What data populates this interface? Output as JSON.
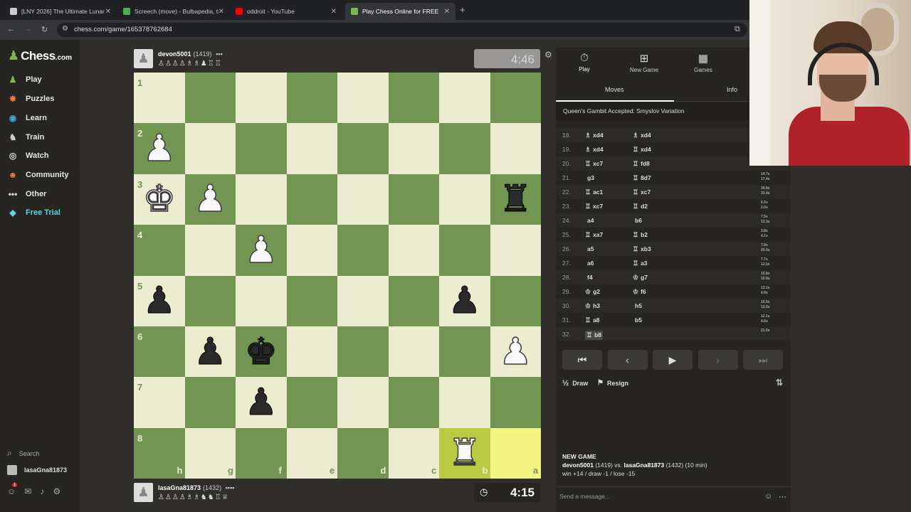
{
  "browser": {
    "tabs": [
      {
        "title": "[LNY 2026] The Ultimate Lunar",
        "color": "#cccccc",
        "active": false
      },
      {
        "title": "Screech (move) - Bulbapedia, th",
        "color": "#4caf50",
        "active": false
      },
      {
        "title": "oddroit - YouTube",
        "color": "#ff0000",
        "active": false
      },
      {
        "title": "Play Chess Online for FREE",
        "color": "#81b64c",
        "active": true
      }
    ],
    "url": "chess.com/game/165378762684"
  },
  "sidebar": {
    "logo_text": "Chess",
    "logo_suffix": ".com",
    "items": [
      {
        "label": "Play",
        "icon": "play-icon",
        "glyph": "♟",
        "color": "#81b64c"
      },
      {
        "label": "Puzzles",
        "icon": "puzzles-icon",
        "glyph": "✸",
        "color": "#f07b3f"
      },
      {
        "label": "Learn",
        "icon": "learn-icon",
        "glyph": "◉",
        "color": "#3fa7d6"
      },
      {
        "label": "Train",
        "icon": "train-icon",
        "glyph": "♞",
        "color": "#cccccc"
      },
      {
        "label": "Watch",
        "icon": "watch-icon",
        "glyph": "◎",
        "color": "#dddddd"
      },
      {
        "label": "Community",
        "icon": "community-icon",
        "glyph": "☻",
        "color": "#e07b39"
      },
      {
        "label": "Other",
        "icon": "other-icon",
        "glyph": "•••",
        "color": "#dddddd"
      },
      {
        "label": "Free Trial",
        "icon": "diamond-icon",
        "glyph": "◆",
        "color": "#5fd3e8"
      }
    ],
    "search_label": "Search",
    "username": "lasaGna81873",
    "notification_count": "1"
  },
  "game": {
    "top_player": {
      "name": "devon5001",
      "rating": "(1419)",
      "flag": "▪▪▪",
      "captured": "♙♙♙♙♗♗♟♖♖",
      "clock": "4:46"
    },
    "bottom_player": {
      "name": "lasaGna81873",
      "rating": "(1432)",
      "flag": "▪▪▪▪",
      "captured": "♙♙♙♙♗♗♞♞♖♕",
      "clock": "4:15"
    },
    "ranks": [
      "1",
      "2",
      "3",
      "4",
      "5",
      "6",
      "7",
      "8"
    ],
    "files": [
      "h",
      "g",
      "f",
      "e",
      "d",
      "c",
      "b",
      "a"
    ],
    "pieces": [
      {
        "glyph": "♟",
        "color": "w",
        "col": 0,
        "row": 1
      },
      {
        "glyph": "♚",
        "color": "w",
        "col": 0,
        "row": 2
      },
      {
        "glyph": "♟",
        "color": "w",
        "col": 1,
        "row": 2
      },
      {
        "glyph": "♜",
        "color": "b",
        "col": 7,
        "row": 2
      },
      {
        "glyph": "♟",
        "color": "w",
        "col": 2,
        "row": 3
      },
      {
        "glyph": "♟",
        "color": "b",
        "col": 0,
        "row": 4
      },
      {
        "glyph": "♟",
        "color": "b",
        "col": 6,
        "row": 4
      },
      {
        "glyph": "♟",
        "color": "b",
        "col": 1,
        "row": 5
      },
      {
        "glyph": "♚",
        "color": "b",
        "col": 2,
        "row": 5
      },
      {
        "glyph": "♟",
        "color": "w",
        "col": 7,
        "row": 5
      },
      {
        "glyph": "♟",
        "color": "b",
        "col": 2,
        "row": 6
      },
      {
        "glyph": "♜",
        "color": "w",
        "col": 6,
        "row": 7
      }
    ],
    "highlights": [
      {
        "col": 6,
        "row": 7
      },
      {
        "col": 7,
        "row": 7
      }
    ]
  },
  "panel": {
    "top_tabs": [
      {
        "label": "Play",
        "icon": "stopwatch-icon",
        "glyph": "⏱"
      },
      {
        "label": "New Game",
        "icon": "plus-icon",
        "glyph": "⊞"
      },
      {
        "label": "Games",
        "icon": "board-icon",
        "glyph": "▦"
      }
    ],
    "subtabs": {
      "moves": "Moves",
      "info": "Info"
    },
    "opening": "Queen's Gambit Accepted: Smyslov Variation",
    "moves": [
      {
        "n": "18.",
        "w": "xd4",
        "wp": "♗",
        "b": "xd4",
        "bp": "♗",
        "tw": "",
        "tb": ""
      },
      {
        "n": "19.",
        "w": "xd4",
        "wp": "♗",
        "b": "xd4",
        "bp": "♖",
        "tw": "",
        "tb": ""
      },
      {
        "n": "20.",
        "w": "xc7",
        "wp": "♖",
        "b": "fd8",
        "bp": "♖",
        "tw": "",
        "tb": ""
      },
      {
        "n": "21.",
        "w": "g3",
        "wp": "",
        "b": "8d7",
        "bp": "♖",
        "tw": "19.7s",
        "tb": "17.4s"
      },
      {
        "n": "22.",
        "w": "ac1",
        "wp": "♖",
        "b": "xc7",
        "bp": "♖",
        "tw": "30.8s",
        "tb": "33.4s"
      },
      {
        "n": "23.",
        "w": "xc7",
        "wp": "♖",
        "b": "d2",
        "bp": "♖",
        "tw": "0.2s",
        "tb": "2.0s"
      },
      {
        "n": "24.",
        "w": "a4",
        "wp": "",
        "b": "b6",
        "bp": "",
        "tw": "7.5s",
        "tb": "13.3s"
      },
      {
        "n": "25.",
        "w": "xa7",
        "wp": "♖",
        "b": "b2",
        "bp": "♖",
        "tw": "3.8s",
        "tb": "4.1s"
      },
      {
        "n": "26.",
        "w": "a5",
        "wp": "",
        "b": "xb3",
        "bp": "♖",
        "tw": "7.9s",
        "tb": "20.0s"
      },
      {
        "n": "27.",
        "w": "a6",
        "wp": "",
        "b": "a3",
        "bp": "♖",
        "tw": "7.7s",
        "tb": "12.5s"
      },
      {
        "n": "28.",
        "w": "f4",
        "wp": "",
        "b": "g7",
        "bp": "♔",
        "tw": "15.8s",
        "tb": "10.9s"
      },
      {
        "n": "29.",
        "w": "g2",
        "wp": "♔",
        "b": "f6",
        "bp": "♔",
        "tw": "13.1s",
        "tb": "4.9s"
      },
      {
        "n": "30.",
        "w": "h3",
        "wp": "♔",
        "b": "h5",
        "bp": "",
        "tw": "15.9s",
        "tb": "13.0s"
      },
      {
        "n": "31.",
        "w": "a8",
        "wp": "♖",
        "b": "b5",
        "bp": "",
        "tw": "12.1s",
        "tb": "4.6s"
      },
      {
        "n": "32.",
        "w": "b8",
        "wp": "♖",
        "b": "",
        "bp": "",
        "tw": "21.0s",
        "tb": ""
      }
    ],
    "controls": [
      {
        "name": "first-move-button",
        "glyph": "⏮",
        "dim": false
      },
      {
        "name": "previous-move-button",
        "glyph": "‹",
        "dim": false
      },
      {
        "name": "play-button",
        "glyph": "▶",
        "dim": false
      },
      {
        "name": "next-move-button",
        "glyph": "›",
        "dim": true
      },
      {
        "name": "last-move-button",
        "glyph": "⏭",
        "dim": true
      }
    ],
    "draw_label": "Draw",
    "draw_icon": "½",
    "resign_label": "Resign",
    "new_game": {
      "heading": "NEW GAME",
      "white": "devon5001",
      "white_rating": "(1419) vs.",
      "black": "lasaGna81873",
      "black_rating": "(1432) (10 min)",
      "stakes": "win +14 / draw -1 / lose -15"
    },
    "chat_placeholder": "Send a message..."
  }
}
